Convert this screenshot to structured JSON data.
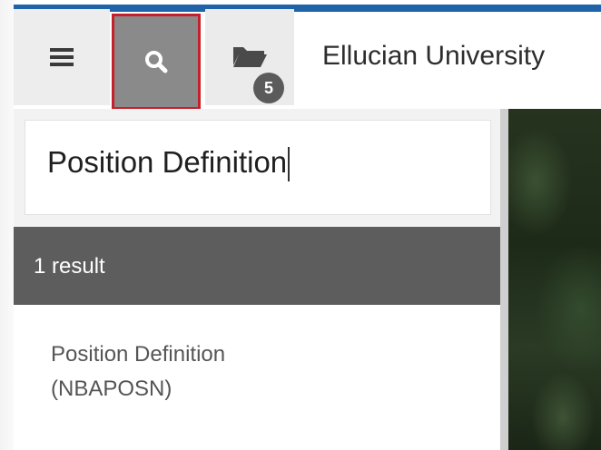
{
  "app": {
    "title": "Ellucian University"
  },
  "toolbar": {
    "menu_icon": "hamburger-menu-icon",
    "search_icon": "search-icon",
    "recent_icon": "folder-icon",
    "recent_count": "5"
  },
  "search": {
    "value": "Position Definition"
  },
  "results": {
    "summary": "1 result",
    "items": [
      {
        "name": "Position Definition",
        "code": "(NBAPOSN)"
      }
    ]
  },
  "colors": {
    "accent": "#1f64a8",
    "highlight": "#c8202a",
    "result_bar": "#5d5d5d"
  }
}
